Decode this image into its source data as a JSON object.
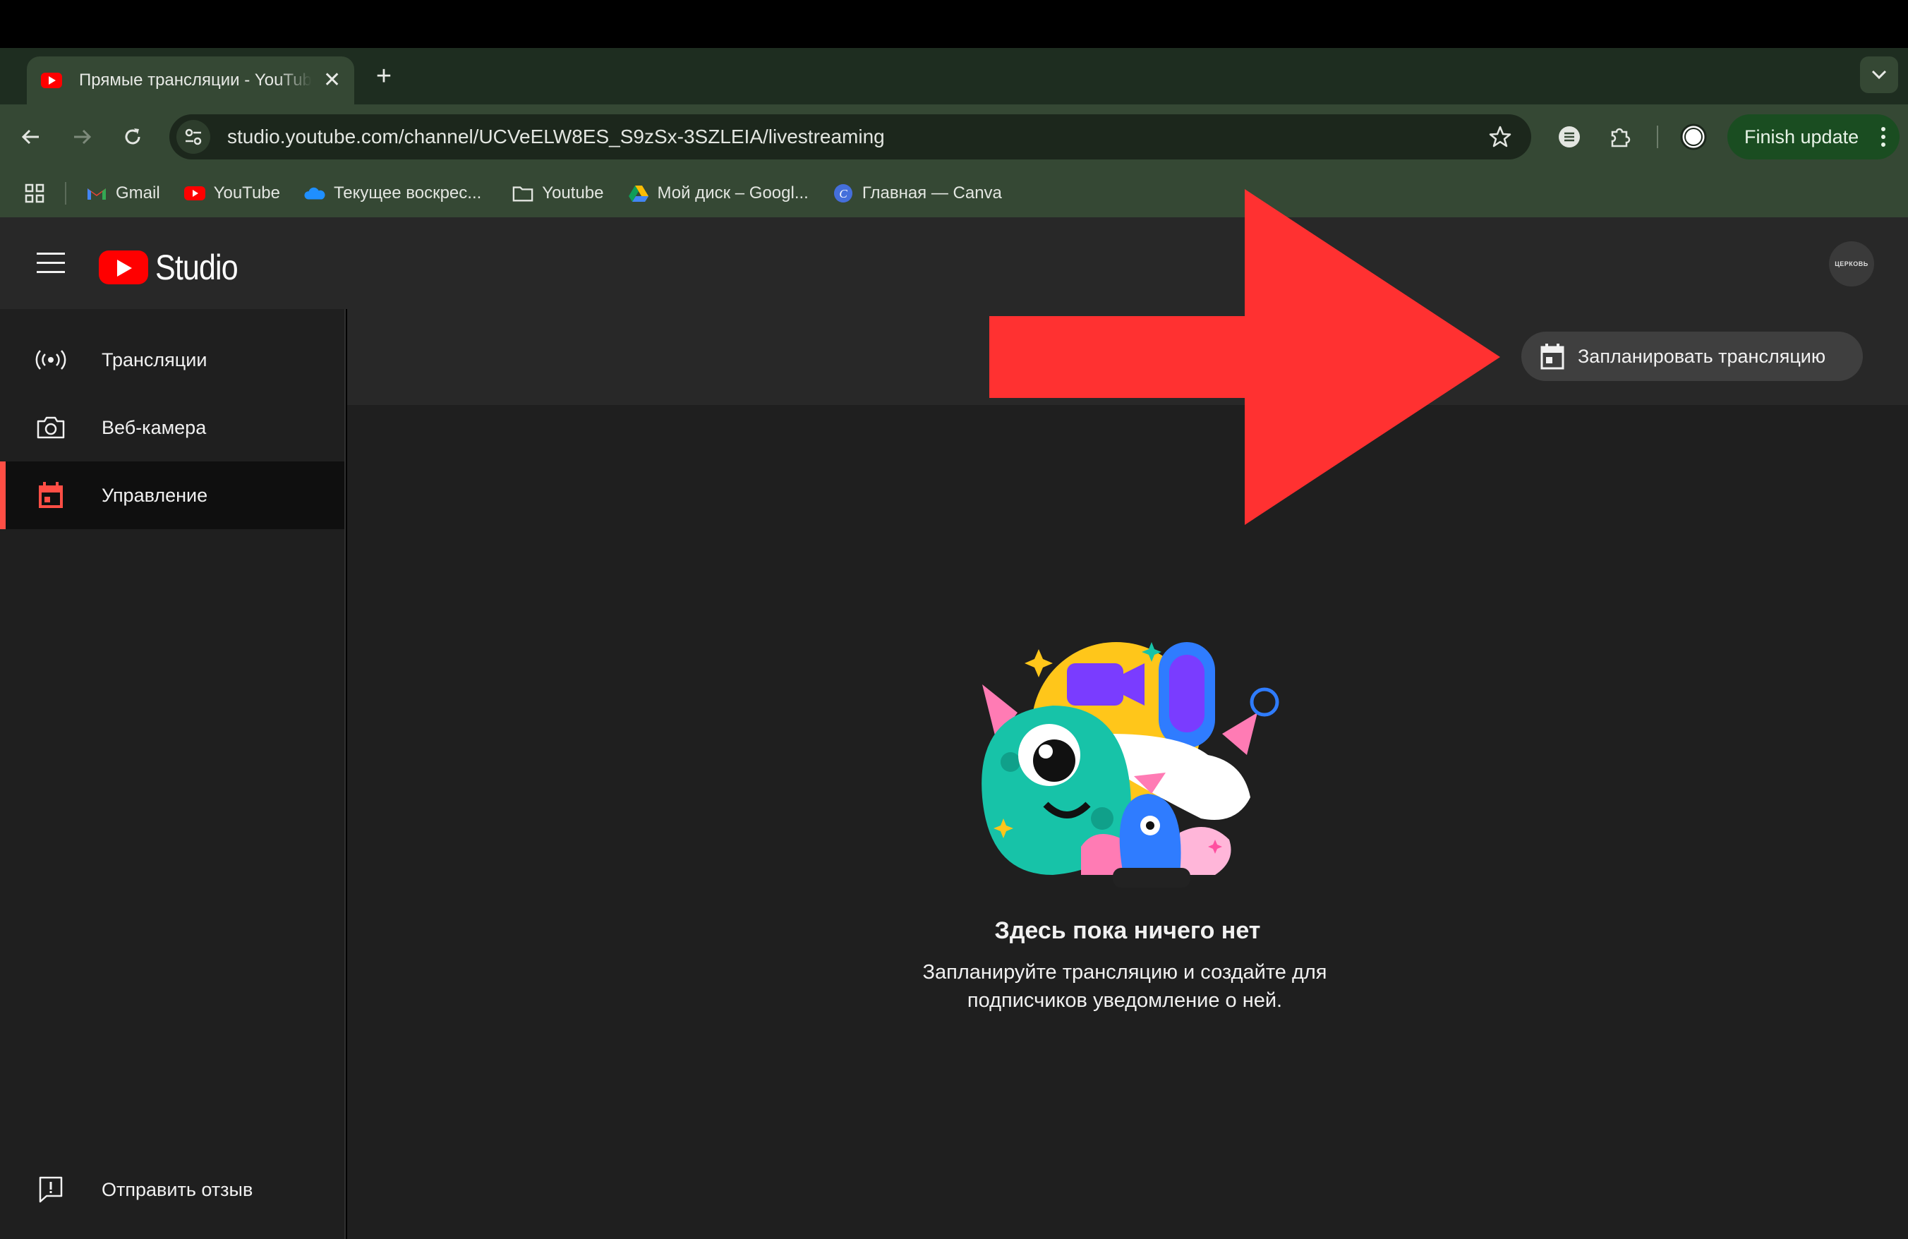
{
  "browser": {
    "tab_title": "Прямые трансляции - YouTube",
    "tab_close_icon": "close-icon",
    "new_tab_glyph": "+",
    "url": "studio.youtube.com/channel/UCVeELW8ES_S9zSx-3SZLEIA/livestreaming",
    "finish_update_label": "Finish update",
    "colors": {
      "tab_bar": "#1e2d20",
      "toolbar": "#354834",
      "omnibox": "#1c271c",
      "update_button": "#1a4d21"
    }
  },
  "bookmarks": [
    {
      "label": "Gmail",
      "icon": "gmail-icon"
    },
    {
      "label": "YouTube",
      "icon": "youtube-icon"
    },
    {
      "label": "Текущее воскрес...",
      "icon": "onedrive-icon"
    },
    {
      "label": "Youtube",
      "icon": "folder-icon"
    },
    {
      "label": "Мой диск – Googl...",
      "icon": "google-drive-icon"
    },
    {
      "label": "Главная — Canva",
      "icon": "canva-icon"
    }
  ],
  "studio": {
    "logo_text": "Studio",
    "avatar_text": "ЦЕРКОВЬ",
    "sidebar": {
      "items": [
        {
          "label": "Трансляции",
          "icon": "live-broadcast-icon",
          "active": false
        },
        {
          "label": "Веб-камера",
          "icon": "camera-icon",
          "active": false
        },
        {
          "label": "Управление",
          "icon": "calendar-icon",
          "active": true
        }
      ],
      "feedback_label": "Отправить отзыв"
    },
    "toolbar": {
      "schedule_label": "Запланировать трансляцию"
    },
    "empty_state": {
      "title": "Здесь пока ничего нет",
      "description": "Запланируйте трансляцию и создайте для подписчиков уведомление о ней."
    },
    "colors": {
      "accent": "#ff4e45",
      "annotation_arrow": "#ff3131",
      "header": "#282828",
      "background": "#1f1f1f"
    }
  }
}
